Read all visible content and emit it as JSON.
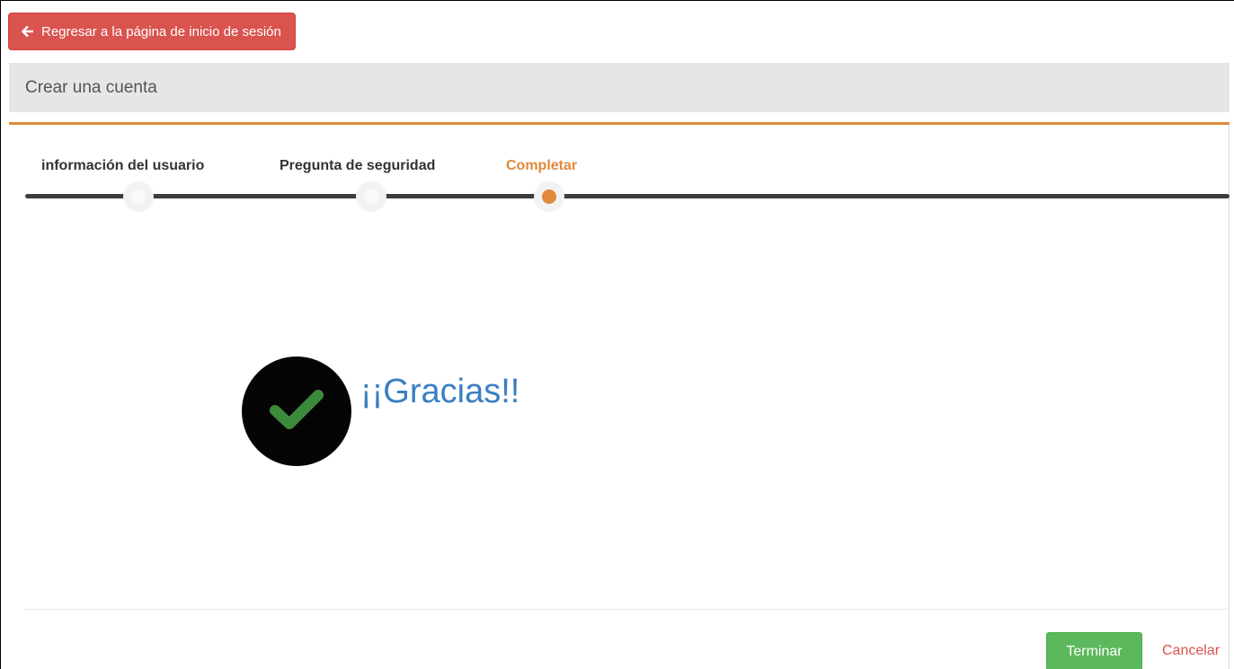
{
  "header": {
    "back_button_label": "Regresar a la página de inicio de sesión",
    "back_icon": "arrow-left-icon"
  },
  "panel": {
    "title": "Crear una cuenta"
  },
  "wizard": {
    "steps": [
      {
        "label": "información del usuario",
        "state": "done"
      },
      {
        "label": "Pregunta de seguridad",
        "state": "done"
      },
      {
        "label": "Completar",
        "state": "active"
      }
    ]
  },
  "content": {
    "success_icon": "check-icon",
    "message": "¡¡Gracias!!"
  },
  "footer": {
    "finish_label": "Terminar",
    "cancel_label": "Cancelar"
  },
  "colors": {
    "danger": "#d9534f",
    "accent": "#e08a3a",
    "success": "#5cb85c",
    "message": "#3a7fc1"
  }
}
